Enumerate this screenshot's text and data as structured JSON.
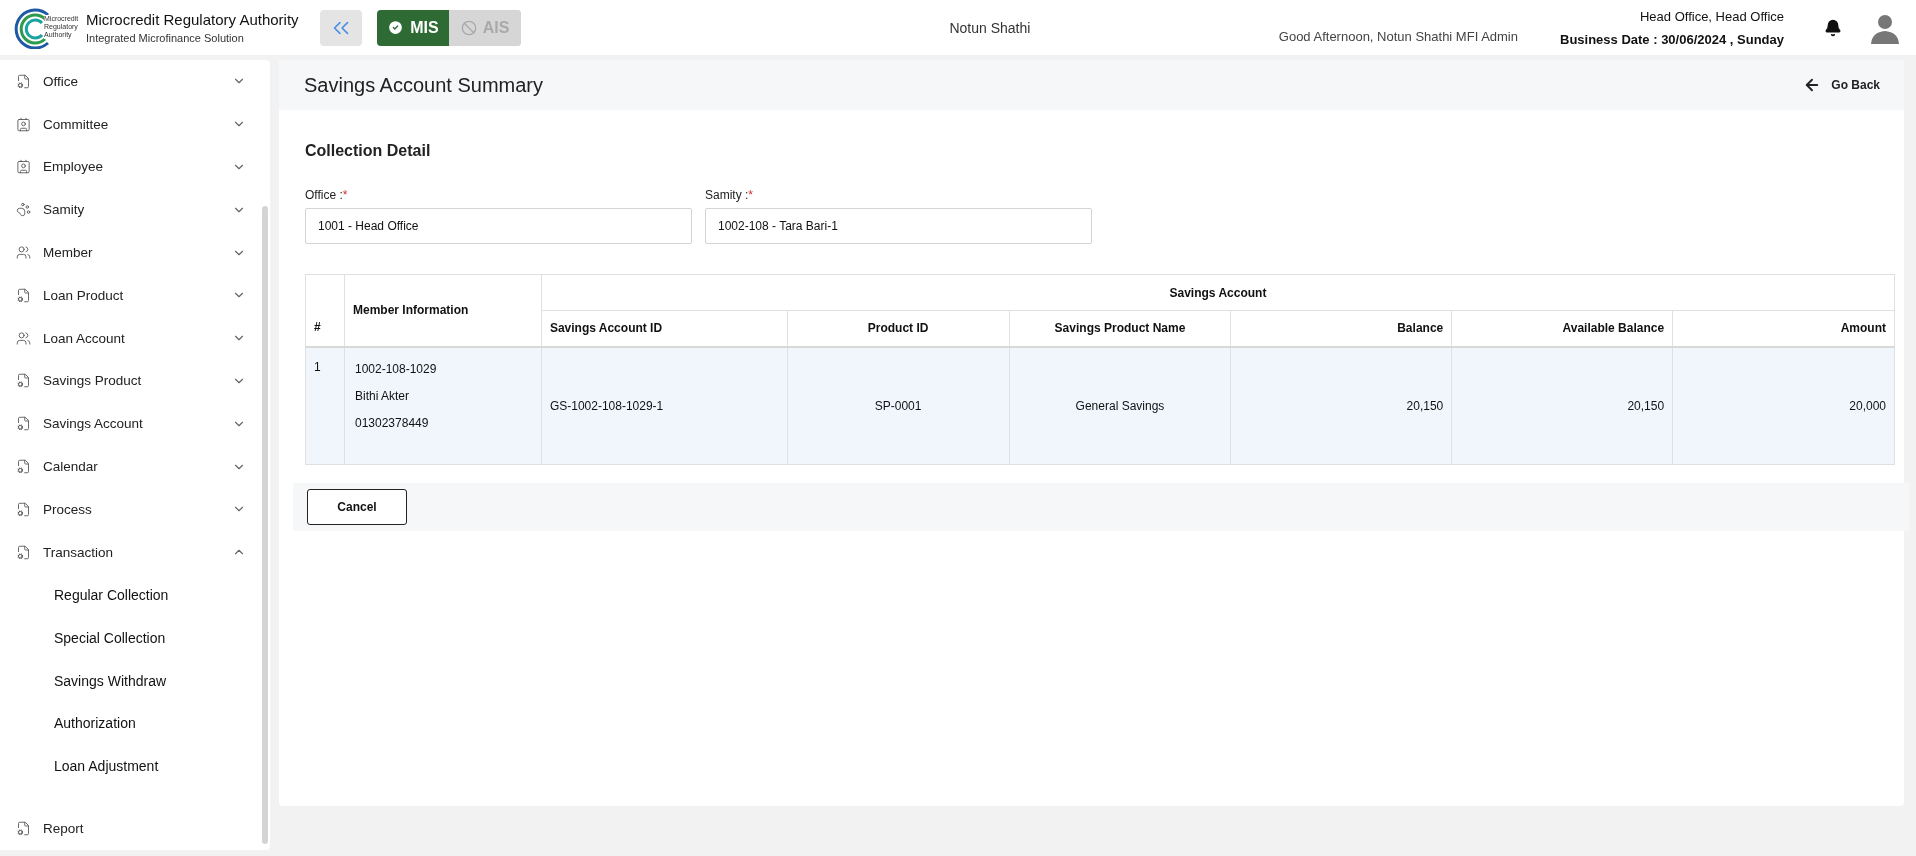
{
  "header": {
    "logo_lines": [
      "Microcredit",
      "Regulatory",
      "Authority"
    ],
    "org_name": "Microcredit Regulatory Authority",
    "org_subtitle": "Integrated Microfinance Solution",
    "modules": [
      {
        "label": "MIS",
        "selected": true
      },
      {
        "label": "AIS",
        "selected": false
      }
    ],
    "institution": "Notun Shathi",
    "greeting": "Good Afternoon, Notun Shathi MFI Admin",
    "office": "Head Office, Head Office",
    "business_date": "Business Date : 30/06/2024 , Sunday"
  },
  "sidebar": {
    "items": [
      {
        "label": "Office",
        "kind": "document",
        "expanded": false
      },
      {
        "label": "Committee",
        "kind": "contact",
        "expanded": false
      },
      {
        "label": "Employee",
        "kind": "contact",
        "expanded": false
      },
      {
        "label": "Samity",
        "kind": "animal",
        "expanded": false
      },
      {
        "label": "Member",
        "kind": "group",
        "expanded": false
      },
      {
        "label": "Loan Product",
        "kind": "document",
        "expanded": false
      },
      {
        "label": "Loan Account",
        "kind": "group",
        "expanded": false
      },
      {
        "label": "Savings Product",
        "kind": "document",
        "expanded": false
      },
      {
        "label": "Savings Account",
        "kind": "document",
        "expanded": false
      },
      {
        "label": "Calendar",
        "kind": "document",
        "expanded": false
      },
      {
        "label": "Process",
        "kind": "document",
        "expanded": false
      },
      {
        "label": "Transaction",
        "kind": "document",
        "expanded": true,
        "children": [
          {
            "label": "Regular Collection"
          },
          {
            "label": "Special Collection"
          },
          {
            "label": "Savings Withdraw"
          },
          {
            "label": "Authorization"
          },
          {
            "label": "Loan Adjustment"
          }
        ]
      }
    ],
    "footer_item": {
      "label": "Report"
    }
  },
  "page": {
    "title": "Savings Account Summary",
    "back_label": "Go Back",
    "section_title": "Collection Detail",
    "fields": [
      {
        "label": "Office :",
        "required": true,
        "required_mark": "*",
        "value": "1001 - Head Office"
      },
      {
        "label": "Samity :",
        "required": true,
        "required_mark": "*",
        "value": "1002-108 - Tara Bari-1"
      }
    ],
    "table": {
      "index_header": "#",
      "member_header": "Member Information",
      "group_header": "Savings Account",
      "columns": [
        {
          "label": "Savings Account ID",
          "kind": "text"
        },
        {
          "label": "Product ID",
          "kind": "code"
        },
        {
          "label": "Savings Product Name",
          "kind": "code"
        },
        {
          "label": "Balance",
          "kind": "amount"
        },
        {
          "label": "Available Balance",
          "kind": "amount"
        },
        {
          "label": "Amount",
          "kind": "amount"
        }
      ],
      "rows": [
        {
          "index": "1",
          "member": [
            "1002-108-1029",
            "Bithi Akter",
            "01302378449"
          ],
          "cells": [
            "GS-1002-108-1029-1",
            "SP-0001",
            "General Savings",
            "20,150",
            "20,150",
            "20,000"
          ]
        }
      ]
    },
    "buttons": [
      "Cancel"
    ]
  }
}
